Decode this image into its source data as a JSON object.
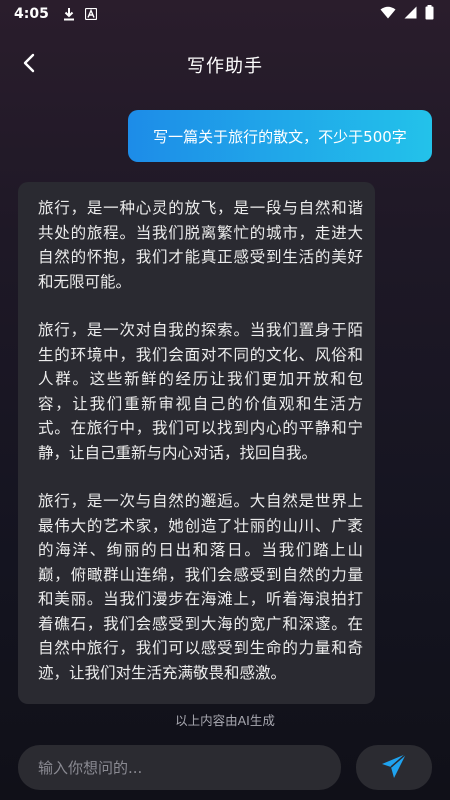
{
  "status_bar": {
    "time": "4:05",
    "icons": [
      "download-icon",
      "a-notification-icon",
      "wifi-icon",
      "signal-icon",
      "battery-icon"
    ]
  },
  "header": {
    "title": "写作助手",
    "back_icon": "chevron-left-icon"
  },
  "chat": {
    "user_message": "写一篇关于旅行的散文，不少于500字",
    "ai_paragraphs": [
      "旅行，是一种心灵的放飞，是一段与自然和谐共处的旅程。当我们脱离繁忙的城市，走进大自然的怀抱，我们才能真正感受到生活的美好和无限可能。",
      "旅行，是一次对自我的探索。当我们置身于陌生的环境中，我们会面对不同的文化、风俗和人群。这些新鲜的经历让我们更加开放和包容，让我们重新审视自己的价值观和生活方式。在旅行中，我们可以找到内心的平静和宁静，让自己重新与内心对话，找回自我。",
      "旅行，是一次与自然的邂逅。大自然是世界上最伟大的艺术家，她创造了壮丽的山川、广袤的海洋、绚丽的日出和落日。当我们踏上山巅，俯瞰群山连绵，我们会感受到自然的力量和美丽。当我们漫步在海滩上，听着海浪拍打着礁石，我们会感受到大海的宽广和深邃。在自然中旅行，我们可以感受到生命的力量和奇迹，让我们对生活充满敬畏和感激。"
    ],
    "ai_note": "以上内容由AI生成"
  },
  "input": {
    "placeholder": "输入你想问的...",
    "value": "",
    "send_icon": "paper-plane-icon"
  },
  "colors": {
    "accent_start": "#1d8ce8",
    "accent_end": "#23c2ea",
    "send_icon": "#1fa3f0",
    "ai_bubble": "#2a2a31"
  }
}
